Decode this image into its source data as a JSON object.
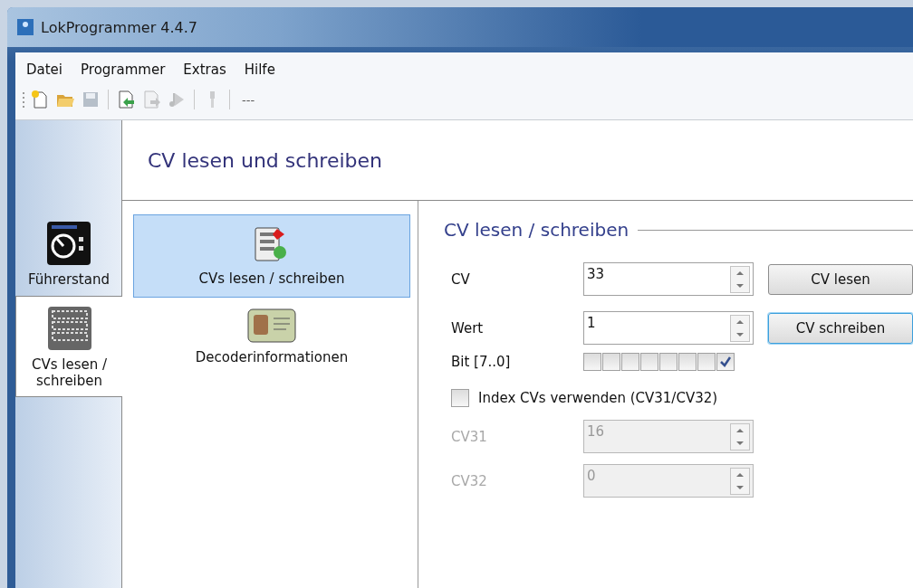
{
  "window": {
    "title": "LokProgrammer 4.4.7"
  },
  "menu": [
    "Datei",
    "Programmer",
    "Extras",
    "Hilfe"
  ],
  "toolbar": [
    {
      "kind": "new",
      "disabled": false
    },
    {
      "kind": "open",
      "disabled": false
    },
    {
      "kind": "save",
      "disabled": true
    },
    {
      "kind": "sep"
    },
    {
      "kind": "import",
      "disabled": false
    },
    {
      "kind": "export",
      "disabled": true
    },
    {
      "kind": "sound",
      "disabled": true
    },
    {
      "kind": "sep"
    },
    {
      "kind": "tool",
      "disabled": true
    },
    {
      "kind": "sep"
    },
    {
      "kind": "text",
      "label": "---"
    }
  ],
  "sidebar": {
    "items": [
      {
        "kind": "cab",
        "label": "Führerstand",
        "selected": false
      },
      {
        "kind": "binary",
        "label": "CVs lesen / schreiben",
        "selected": true
      }
    ]
  },
  "header": {
    "title": "CV lesen und schreiben"
  },
  "pages": [
    {
      "kind": "cv",
      "label": "CVs lesen / schreiben",
      "selected": true
    },
    {
      "kind": "card",
      "label": "Decoderinformationen",
      "selected": false
    }
  ],
  "group": {
    "title": "CV lesen / schreiben",
    "rows": [
      {
        "label": "CV",
        "value": "33",
        "button": "CV lesen",
        "focused": false
      },
      {
        "label": "Wert",
        "value": "1",
        "button": "CV schreiben",
        "focused": true
      }
    ],
    "bits": {
      "label": "Bit [7..0]",
      "items": [
        {
          "checked": false
        },
        {
          "checked": false
        },
        {
          "checked": false
        },
        {
          "checked": false
        },
        {
          "checked": false
        },
        {
          "checked": false
        },
        {
          "checked": false
        },
        {
          "checked": true
        }
      ]
    },
    "index": {
      "label": "Index CVs verwenden (CV31/CV32)",
      "checked": false
    },
    "index_rows": [
      {
        "label": "CV31",
        "value": "16",
        "disabled": true
      },
      {
        "label": "CV32",
        "value": "0",
        "disabled": true
      }
    ]
  }
}
